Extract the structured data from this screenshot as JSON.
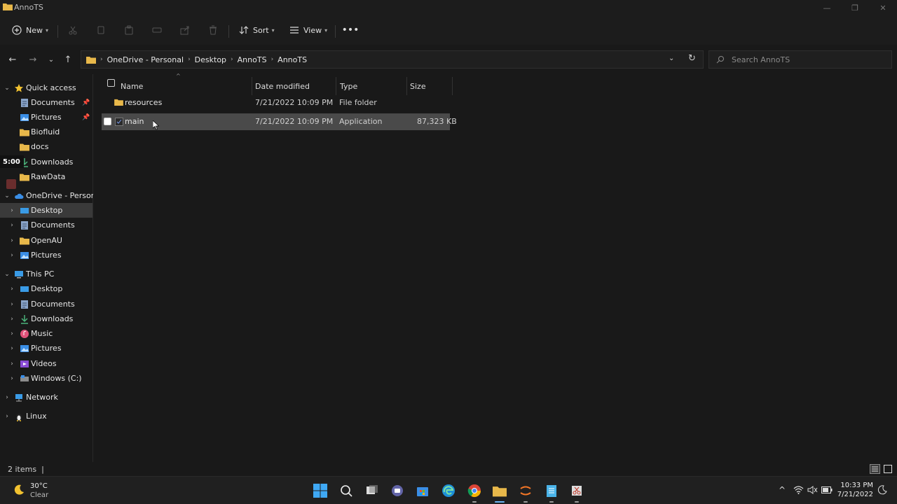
{
  "window": {
    "title": "AnnoTS"
  },
  "toolbar": {
    "new_label": "New",
    "sort_label": "Sort",
    "view_label": "View"
  },
  "address": {
    "crumbs": [
      "OneDrive - Personal",
      "Desktop",
      "AnnoTS",
      "AnnoTS"
    ]
  },
  "search": {
    "placeholder": "Search AnnoTS"
  },
  "navpane": {
    "quick_access": "Quick access",
    "qa_items": [
      "Documents",
      "Pictures",
      "Biofluid",
      "docs",
      "Downloads",
      "RawData"
    ],
    "onedrive": "OneDrive - Personal",
    "od_items": [
      "Desktop",
      "Documents",
      "OpenAU",
      "Pictures"
    ],
    "this_pc": "This PC",
    "pc_items": [
      "Desktop",
      "Documents",
      "Downloads",
      "Music",
      "Pictures",
      "Videos",
      "Windows (C:)"
    ],
    "network": "Network",
    "linux": "Linux"
  },
  "columns": {
    "name": "Name",
    "date": "Date modified",
    "type": "Type",
    "size": "Size"
  },
  "files": [
    {
      "name": "resources",
      "date": "7/21/2022 10:09 PM",
      "type": "File folder",
      "size": ""
    },
    {
      "name": "main",
      "date": "7/21/2022 10:09 PM",
      "type": "Application",
      "size": "87,323 KB"
    }
  ],
  "status": {
    "items": "2 items"
  },
  "overlay": {
    "time": "5:00"
  },
  "weather": {
    "temp": "30°C",
    "cond": "Clear"
  },
  "clock": {
    "time": "10:33 PM",
    "date": "7/21/2022"
  },
  "colors": {
    "folder": "#e8b84a",
    "accent": "#3a8ee6",
    "selected_row": "#4a4a4a"
  }
}
